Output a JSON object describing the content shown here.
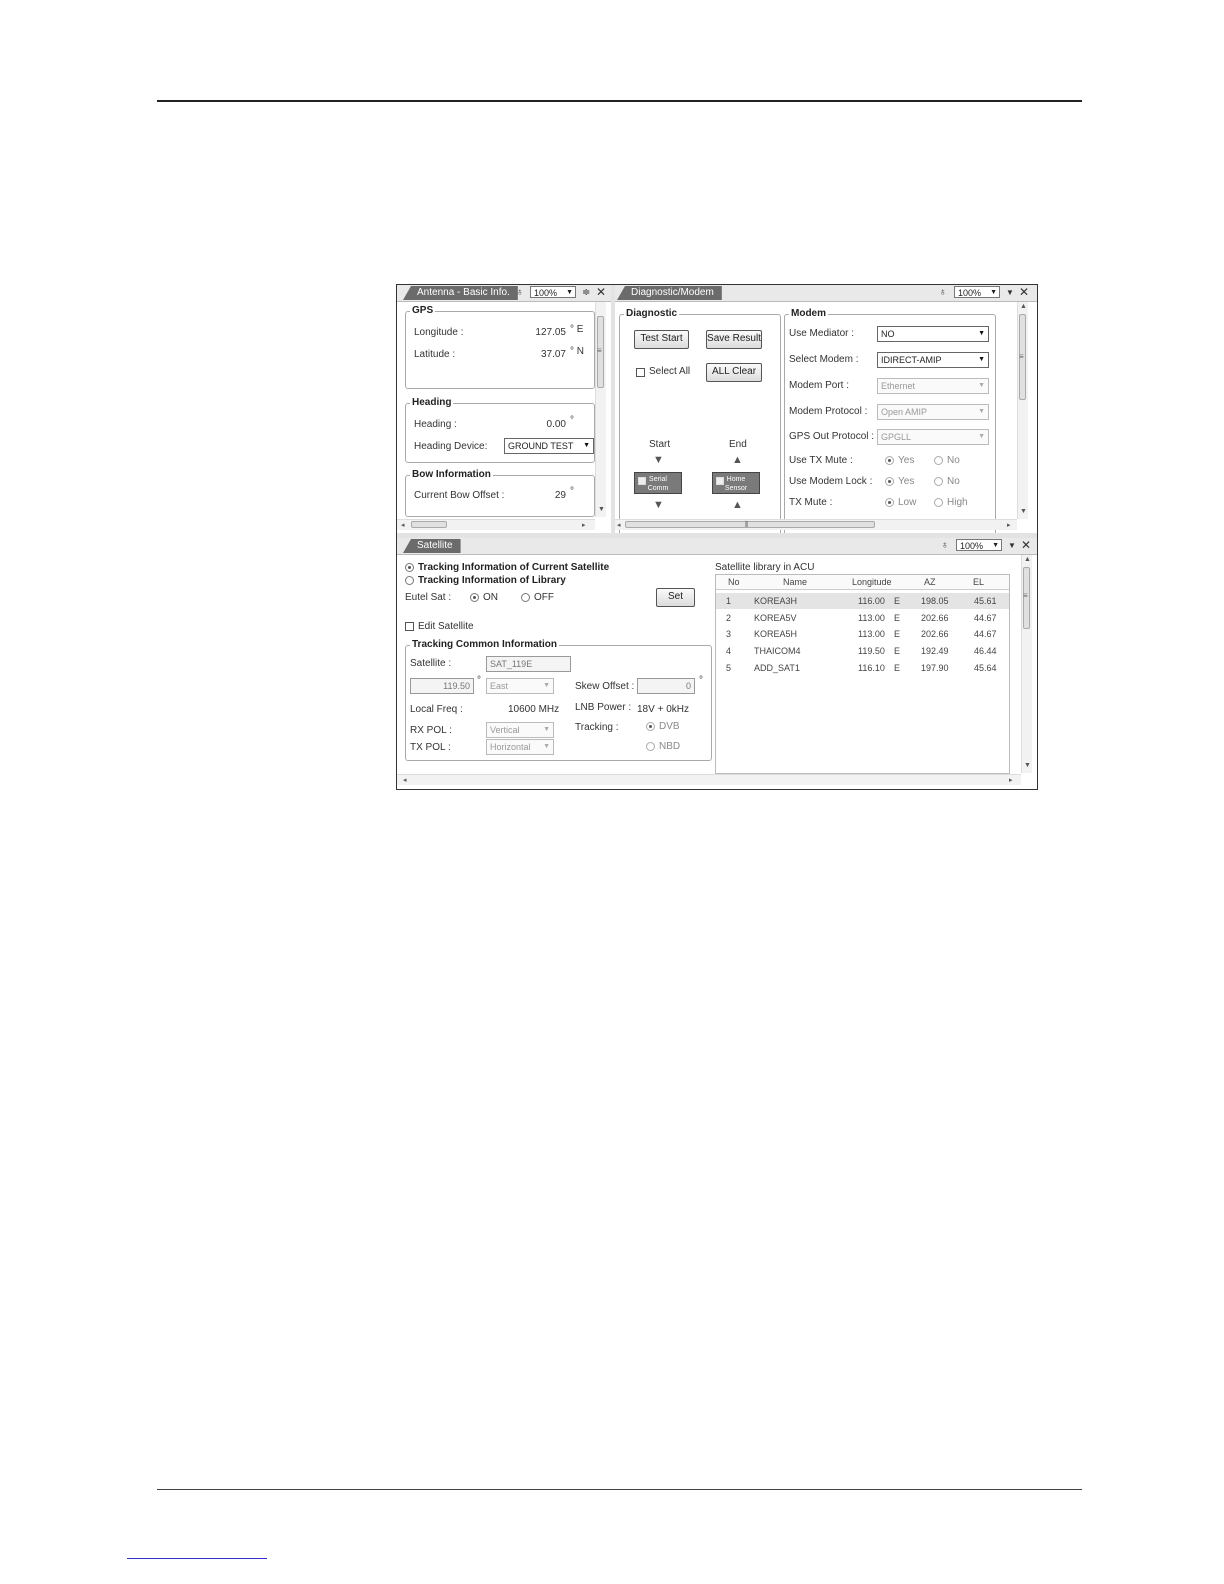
{
  "antenna": {
    "tab": "Antenna - Basic Info.",
    "zoom": "100%",
    "gps": {
      "title": "GPS",
      "longitude_label": "Longitude :",
      "longitude_value": "127.05",
      "longitude_unit": "° E",
      "latitude_label": "Latitude :",
      "latitude_value": "37.07",
      "latitude_unit": "° N"
    },
    "heading": {
      "title": "Heading",
      "heading_label": "Heading :",
      "heading_value": "0.00",
      "heading_unit": "°",
      "device_label": "Heading Device:",
      "device_value": "GROUND TEST"
    },
    "bow": {
      "title": "Bow Information",
      "offset_label": "Current Bow Offset :",
      "offset_value": "29",
      "offset_unit": "°"
    }
  },
  "diagnostic": {
    "tab": "Diagnostic/Modem",
    "zoom": "100%",
    "title": "Diagnostic",
    "test_start": "Test Start",
    "save_result": "Save Result",
    "select_all": "Select All",
    "all_clear": "ALL Clear",
    "start_label": "Start",
    "end_label": "End",
    "start_box_line1": "Serial",
    "start_box_line2": "Comm",
    "end_box_line1": "Home",
    "end_box_line2": "Sensor"
  },
  "modem": {
    "title": "Modem",
    "use_mediator_label": "Use Mediator :",
    "use_mediator_value": "NO",
    "select_modem_label": "Select Modem :",
    "select_modem_value": "IDIRECT-AMIP",
    "modem_port_label": "Modem Port :",
    "modem_port_value": "Ethernet",
    "modem_protocol_label": "Modem Protocol :",
    "modem_protocol_value": "Open AMIP",
    "gps_out_label": "GPS Out Protocol :",
    "gps_out_value": "GPGLL",
    "use_tx_mute_label": "Use TX Mute :",
    "use_modem_lock_label": "Use Modem Lock :",
    "tx_mute_label": "TX Mute :",
    "yes": "Yes",
    "no": "No",
    "low": "Low",
    "high": "High"
  },
  "satellite": {
    "tab": "Satellite",
    "zoom": "100%",
    "opt_current": "Tracking Information of Current Satellite",
    "opt_library": "Tracking Information of Library",
    "eutel_label": "Eutel Sat :",
    "on": "ON",
    "off": "OFF",
    "set_button": "Set",
    "edit_satellite": "Edit Satellite",
    "common": {
      "title": "Tracking Common  Information",
      "satellite_label": "Satellite :",
      "satellite_value": "SAT_119E",
      "longitude_value": "119.50",
      "degree": "°",
      "direction_value": "East",
      "skew_label": "Skew Offset :",
      "skew_value": "0",
      "local_freq_label": "Local Freq :",
      "local_freq_value": "10600 MHz",
      "lnb_label": "LNB Power :",
      "lnb_value": "18V + 0kHz",
      "rx_pol_label": "RX POL :",
      "rx_pol_value": "Vertical",
      "tx_pol_label": "TX POL :",
      "tx_pol_value": "Horizontal",
      "tracking_label": "Tracking :",
      "dvb": "DVB",
      "nbd": "NBD"
    },
    "library": {
      "title": "Satellite library in ACU",
      "columns": [
        "No",
        "Name",
        "Longitude",
        "AZ",
        "EL"
      ],
      "rows": [
        {
          "no": "1",
          "name": "KOREA3H",
          "lon": "116.00",
          "dir": "E",
          "az": "198.05",
          "el": "45.61"
        },
        {
          "no": "2",
          "name": "KOREA5V",
          "lon": "113.00",
          "dir": "E",
          "az": "202.66",
          "el": "44.67"
        },
        {
          "no": "3",
          "name": "KOREA5H",
          "lon": "113.00",
          "dir": "E",
          "az": "202.66",
          "el": "44.67"
        },
        {
          "no": "4",
          "name": "THAICOM4",
          "lon": "119.50",
          "dir": "E",
          "az": "192.49",
          "el": "46.44"
        },
        {
          "no": "5",
          "name": "ADD_SAT1",
          "lon": "116.10",
          "dir": "E",
          "az": "197.90",
          "el": "45.64"
        }
      ]
    }
  }
}
